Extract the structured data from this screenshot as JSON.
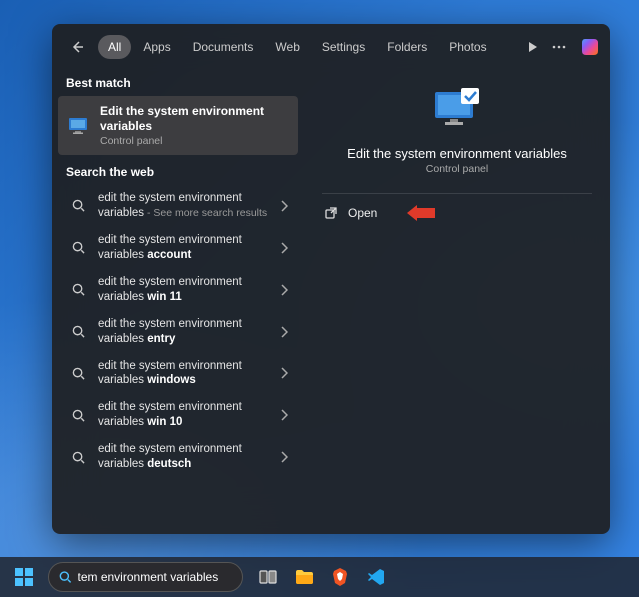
{
  "tabs": [
    "All",
    "Apps",
    "Documents",
    "Web",
    "Settings",
    "Folders",
    "Photos"
  ],
  "activeTab": "All",
  "sections": {
    "best_match_label": "Best match",
    "search_web_label": "Search the web"
  },
  "bestMatch": {
    "title": "Edit the system environment variables",
    "subtitle": "Control panel"
  },
  "webResults": [
    {
      "line1": "edit the system environment",
      "line2_prefix": "variables",
      "line2_bold": "",
      "sub": " - See more search results"
    },
    {
      "line1": "edit the system environment",
      "line2_prefix": "variables ",
      "line2_bold": "account",
      "sub": ""
    },
    {
      "line1": "edit the system environment",
      "line2_prefix": "variables ",
      "line2_bold": "win 11",
      "sub": ""
    },
    {
      "line1": "edit the system environment",
      "line2_prefix": "variables ",
      "line2_bold": "entry",
      "sub": ""
    },
    {
      "line1": "edit the system environment",
      "line2_prefix": "variables ",
      "line2_bold": "windows",
      "sub": ""
    },
    {
      "line1": "edit the system environment",
      "line2_prefix": "variables ",
      "line2_bold": "win 10",
      "sub": ""
    },
    {
      "line1": "edit the system environment",
      "line2_prefix": "variables ",
      "line2_bold": "deutsch",
      "sub": ""
    }
  ],
  "preview": {
    "title": "Edit the system environment variables",
    "subtitle": "Control panel",
    "open_label": "Open"
  },
  "taskbar": {
    "search_value": "tem environment variables"
  }
}
